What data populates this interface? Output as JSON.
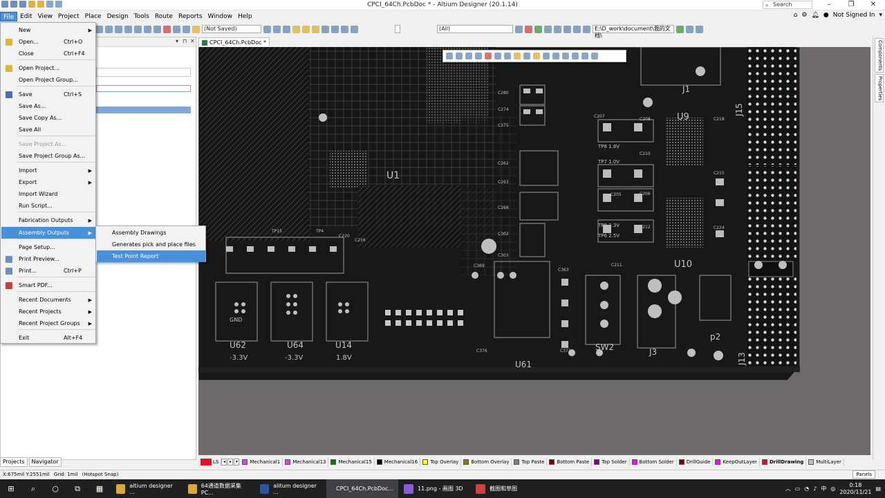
{
  "window": {
    "title": "CPCI_64Ch.PcbDoc * - Altium Designer (20.1.14)",
    "search_placeholder": "Search",
    "signin": "Not Signed In"
  },
  "menubar": [
    "File",
    "Edit",
    "View",
    "Project",
    "Place",
    "Design",
    "Tools",
    "Route",
    "Reports",
    "Window",
    "Help"
  ],
  "toolbar": {
    "not_saved": "(Not Saved)",
    "all": "(All)",
    "path": "E:\\D_work\\document\\我的文档\\"
  },
  "doc_tab": "CPCI_64Ch.PcbDoc *",
  "left_panel": {
    "tabs": [
      "Projects",
      "Navigator"
    ]
  },
  "right_panel_tabs": [
    "Components",
    "Properties"
  ],
  "file_menu": {
    "items": [
      {
        "label": "New",
        "shortcut": "",
        "submenu": true
      },
      {
        "label": "Open...",
        "shortcut": "Ctrl+O"
      },
      {
        "label": "Close",
        "shortcut": "Ctrl+F4"
      },
      {
        "label": "Open Project..."
      },
      {
        "label": "Open Project Group..."
      },
      {
        "label": "Save",
        "shortcut": "Ctrl+S"
      },
      {
        "label": "Save As..."
      },
      {
        "label": "Save Copy As..."
      },
      {
        "label": "Save All"
      },
      {
        "label": "Save Project As...",
        "disabled": true
      },
      {
        "label": "Save Project Group As..."
      },
      {
        "label": "Import",
        "submenu": true
      },
      {
        "label": "Export",
        "submenu": true
      },
      {
        "label": "Import Wizard"
      },
      {
        "label": "Run Script..."
      },
      {
        "label": "Fabrication Outputs",
        "submenu": true
      },
      {
        "label": "Assembly Outputs",
        "submenu": true,
        "highlighted": true
      },
      {
        "label": "Page Setup..."
      },
      {
        "label": "Print Preview..."
      },
      {
        "label": "Print...",
        "shortcut": "Ctrl+P"
      },
      {
        "label": "Smart PDF..."
      },
      {
        "label": "Recent Documents",
        "submenu": true
      },
      {
        "label": "Recent Projects",
        "submenu": true
      },
      {
        "label": "Recent Project Groups",
        "submenu": true
      },
      {
        "label": "Exit",
        "shortcut": "Alt+F4"
      }
    ],
    "submenu": [
      "Assembly Drawings",
      "Generates pick and place files",
      "Test Point Report"
    ]
  },
  "layers": [
    {
      "name": "Mechanical1",
      "color": "#e040e0"
    },
    {
      "name": "Mechanical13",
      "color": "#e040e0"
    },
    {
      "name": "Mechanical15",
      "color": "#008000"
    },
    {
      "name": "Mechanical16",
      "color": "#000000"
    },
    {
      "name": "Top Overlay",
      "color": "#ffff00"
    },
    {
      "name": "Bottom Overlay",
      "color": "#808000"
    },
    {
      "name": "Top Paste",
      "color": "#808080"
    },
    {
      "name": "Bottom Paste",
      "color": "#800000"
    },
    {
      "name": "Top Solder",
      "color": "#800080"
    },
    {
      "name": "Bottom Solder",
      "color": "#ff00ff"
    },
    {
      "name": "DrillGuide",
      "color": "#800000"
    },
    {
      "name": "KeepOutLayer",
      "color": "#ff00ff"
    },
    {
      "name": "DrillDrawing",
      "color": "#ff002a"
    },
    {
      "name": "MultiLayer",
      "color": "#c0c0c0"
    }
  ],
  "layer_ls": "LS",
  "status": {
    "coords": "X:675mil Y:2551mil",
    "grid": "Grid: 1mil",
    "snap": "(Hotspot Snap)",
    "panels": "Panels"
  },
  "pcb_labels": {
    "u1": "U1",
    "u9": "U9",
    "u10": "U10",
    "u61": "U61",
    "u62": "U62",
    "u64": "U64",
    "u14": "U14",
    "j1": "J1",
    "j3": "J3",
    "j13": "J13",
    "j15": "J15",
    "sw2": "SW2",
    "p2": "p2",
    "v33": "-3.3V",
    "v33b": "-3.3V",
    "v18": "1.8V",
    "gnd": "GND",
    "tp8": "TP8 1.8V",
    "tp7": "TP7 1.0V",
    "tp9": "TP9 3.3V",
    "tp6": "TP6 2.5V",
    "c280": "C280",
    "c274": "C274",
    "c275": "C275",
    "c262": "C262",
    "c263": "C263",
    "c268": "C268",
    "c302": "C302",
    "c303": "C303",
    "c207": "C207",
    "c208": "C208",
    "c210": "C210",
    "c205": "C205",
    "c206": "C206",
    "c212": "C212",
    "c211": "C211",
    "c218": "C218",
    "c215": "C215",
    "c224": "C224",
    "c220": "C220",
    "c216": "C216",
    "c369": "C369",
    "c376": "C376",
    "c363": "C363",
    "c371": "C371",
    "tp15": "TP15",
    "tp4": "TP4"
  },
  "taskbar": {
    "items": [
      {
        "label": "altium designer ...",
        "color": "#d9a73b"
      },
      {
        "label": "64通道数据采集PC...",
        "color": "#d9a73b"
      },
      {
        "label": "alitum designer ...",
        "color": "#2b579a"
      },
      {
        "label": "CPCI_64Ch.PcbDoc...",
        "color": "#c8a040",
        "active": true
      },
      {
        "label": "11.png - 画图 3D",
        "color": "#8a5cd6"
      },
      {
        "label": "截图和草图",
        "color": "#d04040"
      }
    ],
    "time": "0:18",
    "date": "2020/11/21"
  }
}
